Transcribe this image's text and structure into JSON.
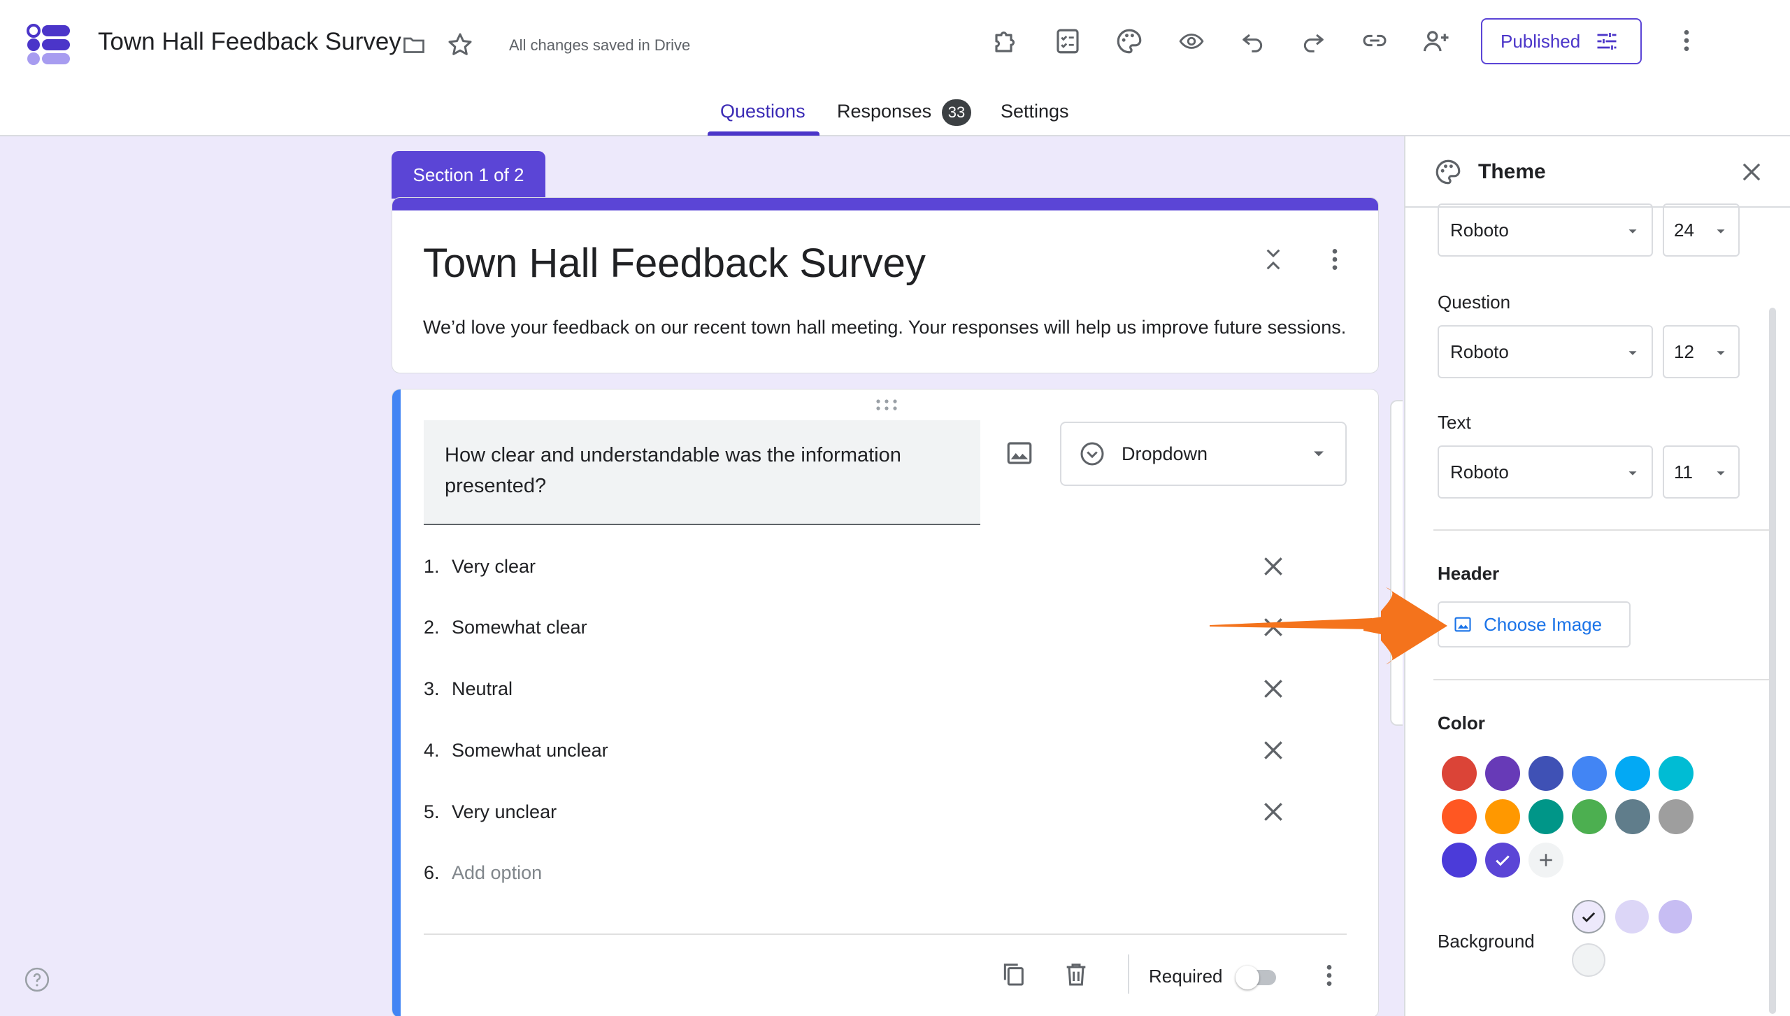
{
  "app": {
    "logo": "forms-logo",
    "doc_title": "Town Hall Feedback Survey",
    "save_status": "All changes saved in Drive"
  },
  "toolbar": {
    "icons": [
      "folder-icon",
      "star-icon",
      "addon-icon",
      "checklist-icon",
      "palette-icon",
      "preview-icon",
      "undo-icon",
      "redo-icon",
      "link-icon",
      "add-collaborator-icon",
      "more-vert-icon"
    ],
    "published_label": "Published"
  },
  "tabs": {
    "questions": "Questions",
    "responses": "Responses",
    "responses_count": "33",
    "settings": "Settings"
  },
  "form": {
    "section_label": "Section 1 of 2",
    "title": "Town Hall Feedback Survey",
    "description": "We’d love your feedback on our recent town hall meeting. Your responses will help us improve future sessions."
  },
  "question": {
    "text": "How clear and understandable was the information presented?",
    "type": "Dropdown",
    "options": [
      {
        "num": "1.",
        "label": "Very clear"
      },
      {
        "num": "2.",
        "label": "Somewhat clear"
      },
      {
        "num": "3.",
        "label": "Neutral"
      },
      {
        "num": "4.",
        "label": "Somewhat unclear"
      },
      {
        "num": "5.",
        "label": "Very unclear"
      }
    ],
    "add_option": {
      "num": "6.",
      "label": "Add option"
    },
    "required_label": "Required",
    "required": false
  },
  "theme": {
    "title": "Theme",
    "header_font": "Roboto",
    "header_size": "24",
    "question_label": "Question",
    "question_font": "Roboto",
    "question_size": "12",
    "text_label": "Text",
    "text_font": "Roboto",
    "text_size": "11",
    "header_section_label": "Header",
    "choose_image_label": "Choose Image",
    "color_label": "Color",
    "colors": [
      "#db4437",
      "#673ab7",
      "#3f51b5",
      "#4285f4",
      "#03a9f4",
      "#00bcd4",
      "#ff5722",
      "#ff9800",
      "#009688",
      "#4caf50",
      "#607d8b",
      "#9e9e9e",
      "#4b3bd9",
      "#5b45d6"
    ],
    "selected_color": "#5b45d6",
    "background_label": "Background",
    "backgrounds": [
      "#ede9fb",
      "#dcd6f7",
      "#c7bdf3",
      "#f1f3f4"
    ],
    "selected_background": "#ede9fb"
  },
  "accent": "#5b45d6",
  "callout_color": "#f4731c"
}
